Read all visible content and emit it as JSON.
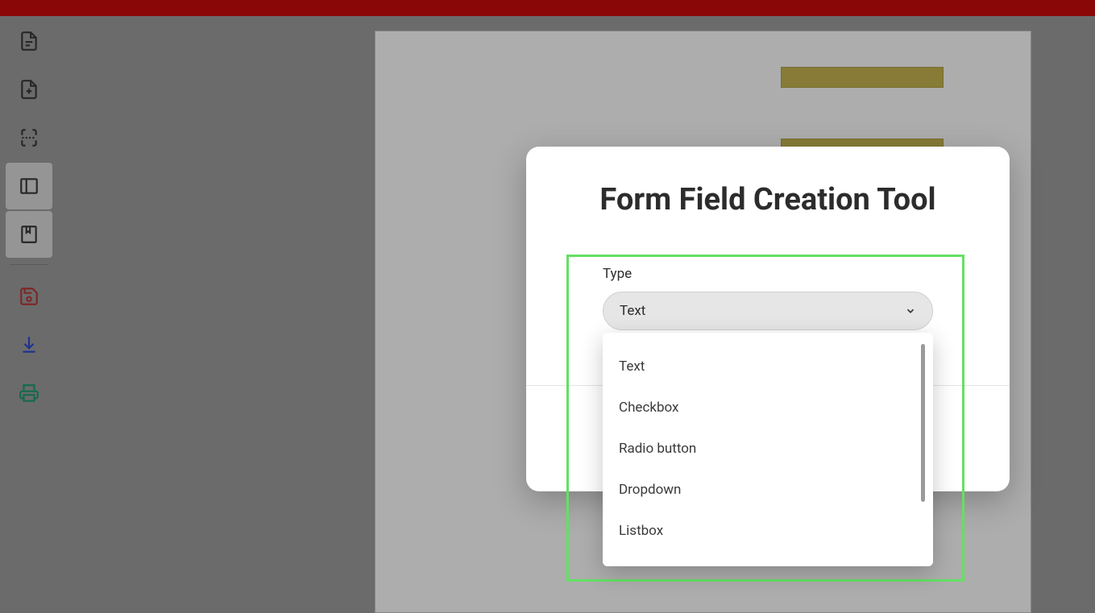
{
  "sidebar": {
    "items": [
      {
        "name": "file-icon"
      },
      {
        "name": "add-page-icon"
      },
      {
        "name": "page-break-icon"
      },
      {
        "name": "panel-toggle-icon",
        "active": true
      },
      {
        "name": "bookmark-icon",
        "active": true
      },
      {
        "name": "save-icon"
      },
      {
        "name": "download-icon"
      },
      {
        "name": "print-icon"
      }
    ]
  },
  "modal": {
    "title": "Form Field Creation Tool",
    "type_label": "Type",
    "selected_type": "Text",
    "options": [
      "Text",
      "Checkbox",
      "Radio button",
      "Dropdown",
      "Listbox"
    ]
  }
}
